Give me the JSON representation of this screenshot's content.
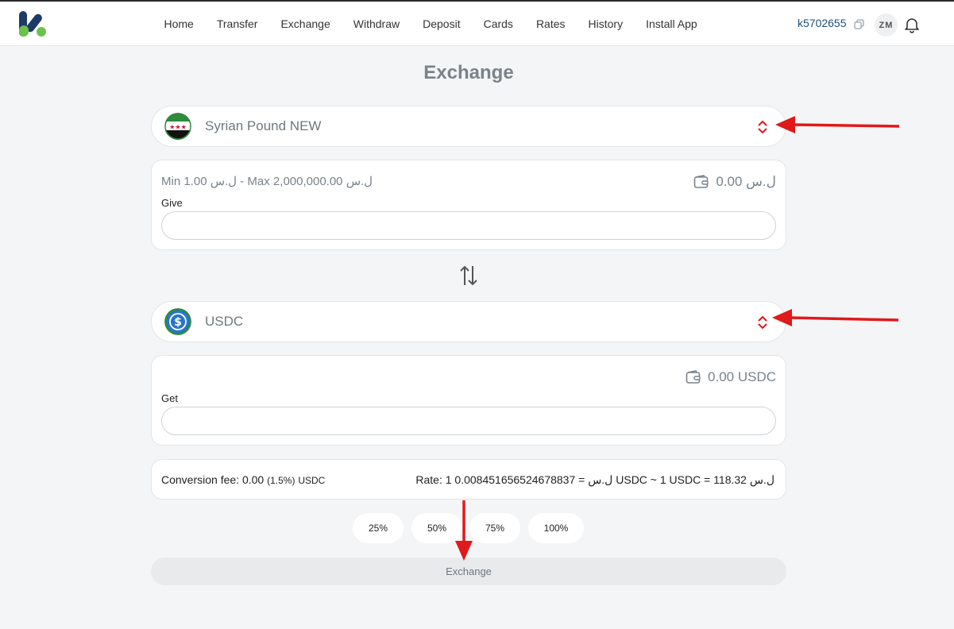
{
  "nav": {
    "items": [
      "Home",
      "Transfer",
      "Exchange",
      "Withdraw",
      "Deposit",
      "Cards",
      "Rates",
      "History",
      "Install App"
    ]
  },
  "account": {
    "id": "k5702655",
    "initials": "ZM"
  },
  "page": {
    "title": "Exchange"
  },
  "from": {
    "currency_name": "Syrian Pound NEW",
    "limits": "Min 1.00 ل.س   -   Max 2,000,000.00 ل.س",
    "balance": "ل.س 0.00",
    "label": "Give",
    "value": "",
    "placeholder": ""
  },
  "to": {
    "currency_name": "USDC",
    "balance": "0.00 USDC",
    "label": "Get",
    "value": "",
    "placeholder": ""
  },
  "conversion": {
    "fee_label": "Conversion fee:",
    "fee_value": "0.00",
    "fee_percent": "(1.5%)",
    "fee_currency": "USDC",
    "rate_text": "Rate: 1 ل.س = 0.008451656524678837 USDC  ~ 1 USDC = 118.32 ل.س"
  },
  "percent_buttons": [
    "25%",
    "50%",
    "75%",
    "100%"
  ],
  "submit_label": "Exchange",
  "colors": {
    "brand_navy": "#1d3a6b",
    "brand_green": "#6cc24a",
    "annotation_arrow": "#e0191b",
    "usdc_blue": "#2775ca"
  },
  "icons": [
    "brand-logo",
    "copy-icon",
    "bell-icon",
    "syria-flag-icon",
    "usdc-icon",
    "chevron-updown-icon",
    "wallet-icon",
    "swap-arrows-icon"
  ]
}
